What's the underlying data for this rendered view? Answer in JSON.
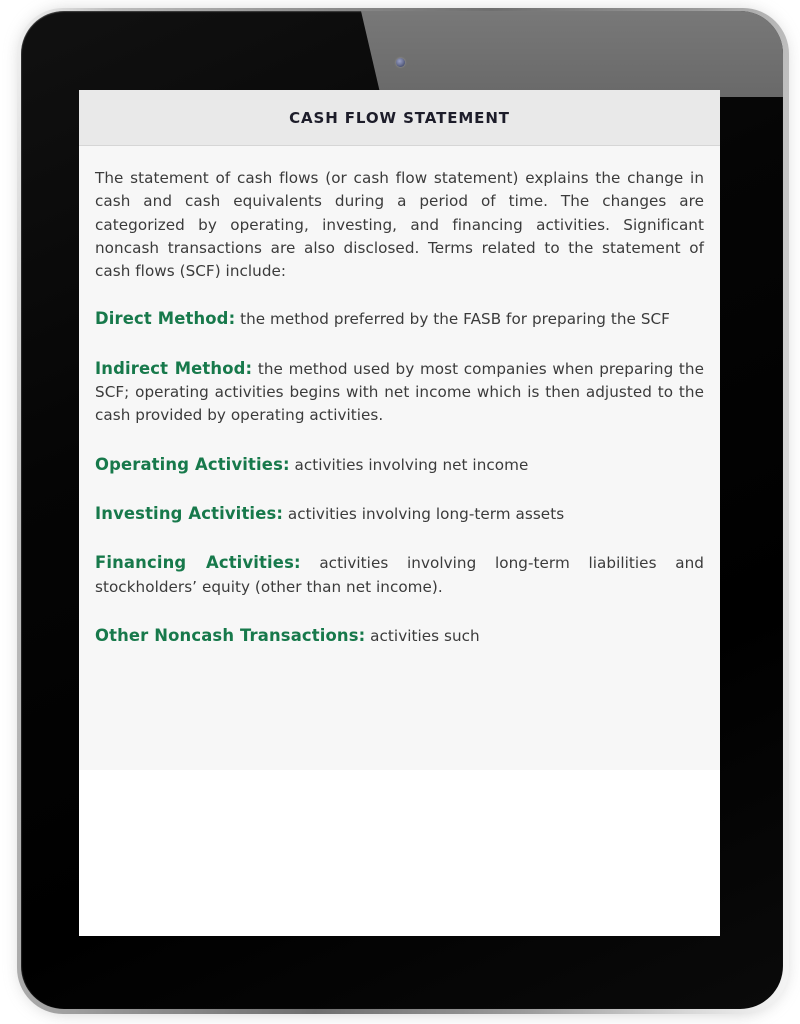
{
  "device": {
    "type": "tablet",
    "camera_label": "front-camera",
    "bezel_color": "#040404",
    "edge_color": "#8e8e8e"
  },
  "document": {
    "title": "CASH FLOW STATEMENT",
    "accent_color": "#17794b",
    "body_text_color": "#3b3b3b",
    "header_background": "#e9e9e9",
    "content_background": "#f7f7f7",
    "intro": "The statement of cash flows (or cash flow statement) explains the change in cash and cash equivalents during a period of time. The changes are categorized by operating, investing, and financing activities. Significant noncash transactions are also disclosed. Terms related to the statement of cash flows (SCF) include:",
    "terms": [
      {
        "term": "Direct Method",
        "separator": ":",
        "definition": "the method preferred by the FASB for preparing the SCF"
      },
      {
        "term": "Indirect Method",
        "separator": ":",
        "definition": "the method used by most companies when preparing the SCF; operating activities begins with net income which is then adjusted to the cash provided by operating activities."
      },
      {
        "term": "Operating Activities",
        "separator": ":",
        "definition": "activities involving net income"
      },
      {
        "term": "Investing Activities",
        "separator": ":",
        "definition": "activities involving long-term assets"
      },
      {
        "term": "Financing Activities",
        "separator": ":",
        "definition": "activities involving long-term liabilities and stockholders’ equity (other than net income)."
      },
      {
        "term": "Other Noncash Transactions",
        "separator": ":",
        "definition": "activities such"
      }
    ]
  }
}
